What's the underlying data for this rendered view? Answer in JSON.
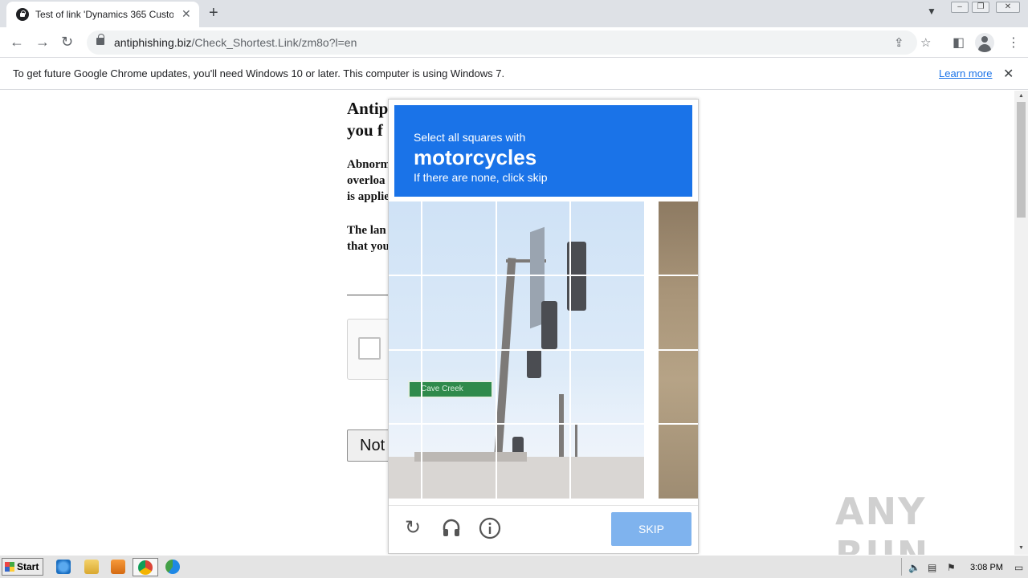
{
  "browser": {
    "tab_title": "Test of link 'Dynamics 365 Customer",
    "tab_close": "✕",
    "new_tab": "+",
    "url_domain": "antiphishing.biz",
    "url_path": "/Check_Shortest.Link/zm8o?l=en"
  },
  "infobar": {
    "message": "To get future Google Chrome updates, you'll need Windows 10 or later. This computer is using Windows 7.",
    "learn_more": "Learn more",
    "close": "✕"
  },
  "page": {
    "heading_line1": "Antip",
    "heading_line2": "you f",
    "para1_line1": "Abnorm",
    "para1_line2": "overloa",
    "para1_line3": "is applie",
    "para2_line1": "The lan",
    "para2_line2": "that you",
    "button_label": "Not"
  },
  "captcha": {
    "instruction": "Select all squares with",
    "target": "motorcycles",
    "hint": "If there are none, click skip",
    "street_sign": "Cave Creek",
    "skip_label": "SKIP",
    "icons": [
      "reload-icon",
      "audio-icon",
      "info-icon"
    ]
  },
  "watermark": "ANY RUN",
  "taskbar": {
    "start_label": "Start",
    "clock": "3:08 PM"
  },
  "colors": {
    "captcha_header": "#1a73e8",
    "skip_button": "#7fb3ee",
    "link": "#1a73e8"
  }
}
